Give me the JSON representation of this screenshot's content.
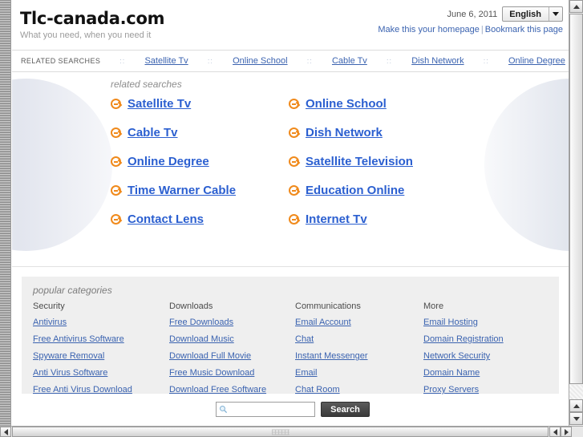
{
  "header": {
    "site_title": "Tlc-canada.com",
    "tagline": "What you need, when you need it",
    "date": "June 6, 2011",
    "language": "English",
    "homepage_link": "Make this your homepage",
    "separator": "|",
    "bookmark_link": "Bookmark this page"
  },
  "related_strip": {
    "label": "RELATED SEARCHES",
    "dots": "::",
    "links": [
      "Satellite Tv",
      "Online School",
      "Cable Tv",
      "Dish Network",
      "Online Degree"
    ]
  },
  "hero": {
    "heading": "related searches",
    "items": [
      "Satellite Tv",
      "Online School",
      "Cable Tv",
      "Dish Network",
      "Online Degree",
      "Satellite Television",
      "Time Warner Cable",
      "Education Online",
      "Contact Lens",
      "Internet Tv"
    ]
  },
  "categories": {
    "heading": "popular categories",
    "columns": [
      {
        "title": "Security",
        "links": [
          "Antivirus",
          "Free Antivirus Software",
          "Spyware Removal",
          "Anti Virus Software",
          "Free Anti Virus Download"
        ]
      },
      {
        "title": "Downloads",
        "links": [
          "Free Downloads",
          "Download Music",
          "Download Full Movie",
          "Free Music Download",
          "Download Free Software"
        ]
      },
      {
        "title": "Communications",
        "links": [
          "Email Account",
          "Chat",
          "Instant Messenger",
          "Email",
          "Chat Room"
        ]
      },
      {
        "title": "More",
        "links": [
          "Email Hosting",
          "Domain Registration",
          "Network Security",
          "Domain Name",
          "Proxy Servers"
        ]
      }
    ]
  },
  "search": {
    "value": "",
    "placeholder": "",
    "button_label": "Search",
    "icon": "magnifier-icon"
  },
  "icons": {
    "bullet": "arrow-circle-right-icon",
    "lang_caret": "chevron-down-icon",
    "scroll_up": "caret-up-icon",
    "scroll_down": "caret-down-icon",
    "scroll_left": "caret-left-icon",
    "scroll_right": "caret-right-icon"
  },
  "colors": {
    "link": "#3b63b0",
    "hero_link": "#2b5fd0",
    "bullet": "#f08a1c",
    "category_panel": "#efefef",
    "search_button": "#3a3a3a"
  }
}
